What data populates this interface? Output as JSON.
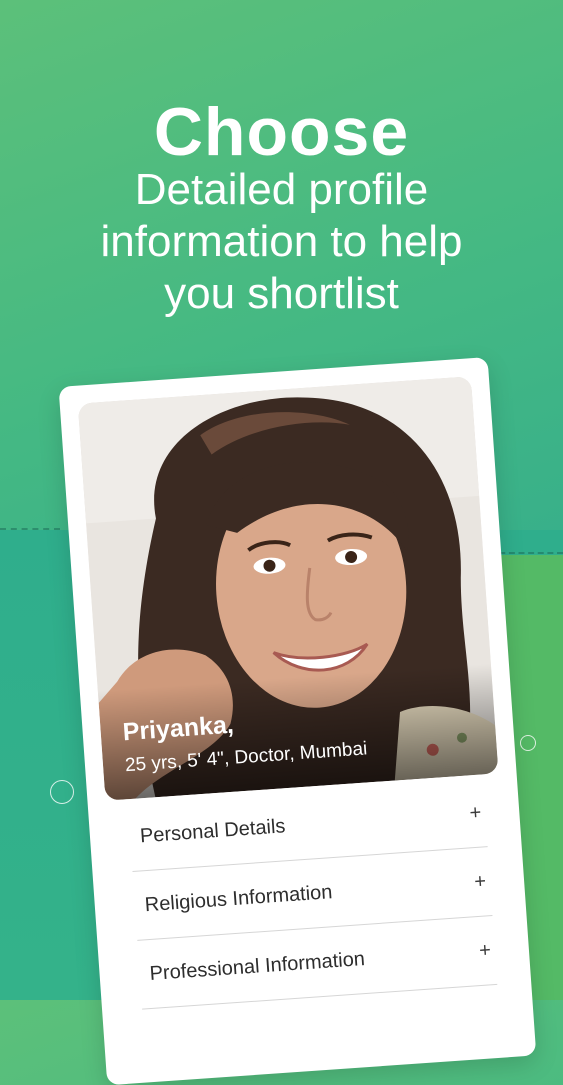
{
  "header": {
    "title": "Choose",
    "subtitle_lines": [
      "Detailed profile",
      "information to help",
      "you shortlist"
    ]
  },
  "profile": {
    "name": "Priyanka,",
    "details": "25 yrs, 5' 4\", Doctor, Mumbai",
    "photo": "profile-photo"
  },
  "sections": [
    {
      "label": "Personal Details",
      "icon": "plus-icon"
    },
    {
      "label": "Religious Information",
      "icon": "plus-icon"
    },
    {
      "label": "Professional Information",
      "icon": "plus-icon"
    }
  ],
  "colors": {
    "background_top": "#5cc07a",
    "background_bottom": "#2ea48c",
    "card": "#ffffff",
    "text_on_bg": "#ffffff"
  }
}
